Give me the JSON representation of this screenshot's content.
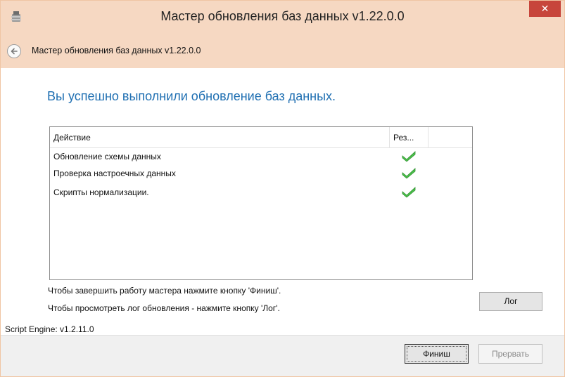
{
  "window": {
    "title": "Мастер обновления баз данных v1.22.0.0",
    "close_glyph": "✕",
    "app_icon": "database-wizard-icon"
  },
  "nav": {
    "back_icon": "back-arrow-icon",
    "title": "Мастер обновления баз данных v1.22.0.0"
  },
  "main": {
    "success_message": "Вы успешно выполнили обновление баз данных.",
    "table": {
      "columns": [
        "Действие",
        "Рез..."
      ],
      "rows": [
        {
          "action": "Обновление схемы данных",
          "result_icon": "green-check-icon"
        },
        {
          "action": "Проверка настроечных данных",
          "result_icon": "green-check-icon"
        },
        {
          "action": "Скрипты нормализации.",
          "result_icon": "green-check-icon"
        }
      ]
    },
    "hint_finish": "Чтобы завершить работу мастера нажмите кнопку 'Финиш'.",
    "hint_log": "Чтобы просмотреть лог обновления - нажмите кнопку 'Лог'.",
    "log_button": "Лог"
  },
  "footer": {
    "engine_version": "Script Engine: v1.2.11.0",
    "finish_button": "Финиш",
    "cancel_button": "Прервать"
  },
  "colors": {
    "titlebar": "#f6d8c2",
    "close": "#c7453b",
    "accent_text": "#1f6fb2",
    "check": "#4bbf4b"
  }
}
